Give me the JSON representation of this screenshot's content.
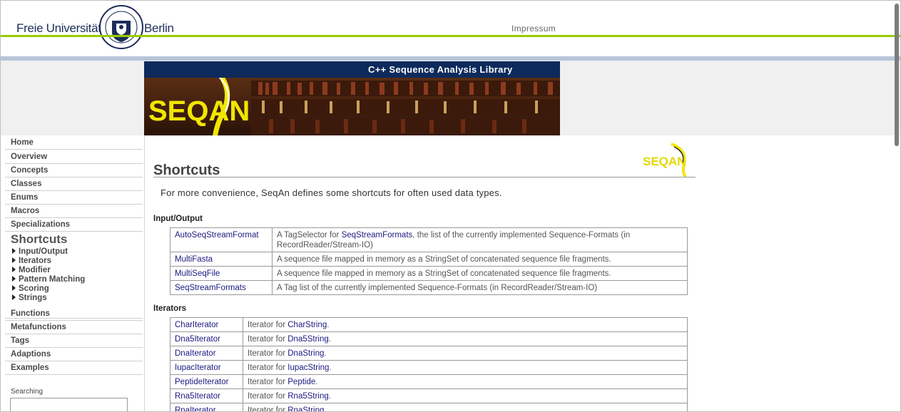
{
  "header": {
    "uni_left": "Freie Universität",
    "uni_right": "Berlin",
    "impressum": "Impressum"
  },
  "banner": {
    "subtitle": "C++ Sequence Analysis Library",
    "logo_text": "SEQAN"
  },
  "sidebar": {
    "items_top": [
      "Home",
      "Overview",
      "Concepts",
      "Classes",
      "Enums",
      "Macros",
      "Specializations"
    ],
    "active": "Shortcuts",
    "subitems": [
      "Input/Output",
      "Iterators",
      "Modifier",
      "Pattern Matching",
      "Scoring",
      "Strings"
    ],
    "items_bottom": [
      "Functions",
      "Metafunctions",
      "Tags",
      "Adaptions",
      "Examples"
    ],
    "search_label": "Searching",
    "search_value": ""
  },
  "main": {
    "title": "Shortcuts",
    "intro": "For more convenience, SeqAn defines some shortcuts for often used data types.",
    "sections": [
      {
        "heading": "Input/Output",
        "rows": [
          {
            "name": "AutoSeqStreamFormat",
            "desc_pre": "A TagSelector for ",
            "desc_link": "SeqStreamFormats",
            "desc_post": ", the list of the currently implemented Sequence-Formats (in RecordReader/Stream-IO)"
          },
          {
            "name": "MultiFasta",
            "desc_pre": "A sequence file mapped in memory as a StringSet of concatenated sequence file fragments.",
            "desc_link": "",
            "desc_post": ""
          },
          {
            "name": "MultiSeqFile",
            "desc_pre": "A sequence file mapped in memory as a StringSet of concatenated sequence file fragments.",
            "desc_link": "",
            "desc_post": ""
          },
          {
            "name": "SeqStreamFormats",
            "desc_pre": "A Tag list of the currently implemented Sequence-Formats (in RecordReader/Stream-IO)",
            "desc_link": "",
            "desc_post": ""
          }
        ]
      },
      {
        "heading": "Iterators",
        "rows": [
          {
            "name": "CharIterator",
            "desc_pre": "Iterator for ",
            "desc_link": "CharString",
            "desc_post": "."
          },
          {
            "name": "Dna5Iterator",
            "desc_pre": "Iterator for ",
            "desc_link": "Dna5String",
            "desc_post": "."
          },
          {
            "name": "DnaIterator",
            "desc_pre": "Iterator for ",
            "desc_link": "DnaString",
            "desc_post": "."
          },
          {
            "name": "IupacIterator",
            "desc_pre": "Iterator for ",
            "desc_link": "IupacString",
            "desc_post": "."
          },
          {
            "name": "PeptideIterator",
            "desc_pre": "Iterator for ",
            "desc_link": "Peptide",
            "desc_post": "."
          },
          {
            "name": "Rna5Iterator",
            "desc_pre": "Iterator for ",
            "desc_link": "Rna5String",
            "desc_post": "."
          },
          {
            "name": "RnaIterator",
            "desc_pre": "Iterator for ",
            "desc_link": "RnaString",
            "desc_post": "."
          }
        ]
      }
    ]
  },
  "colors": {
    "fu_green": "#99cc00",
    "banner_blue": "#0c2a5c",
    "link": "#1a1a80",
    "seqan_yellow": "#f2e600"
  }
}
